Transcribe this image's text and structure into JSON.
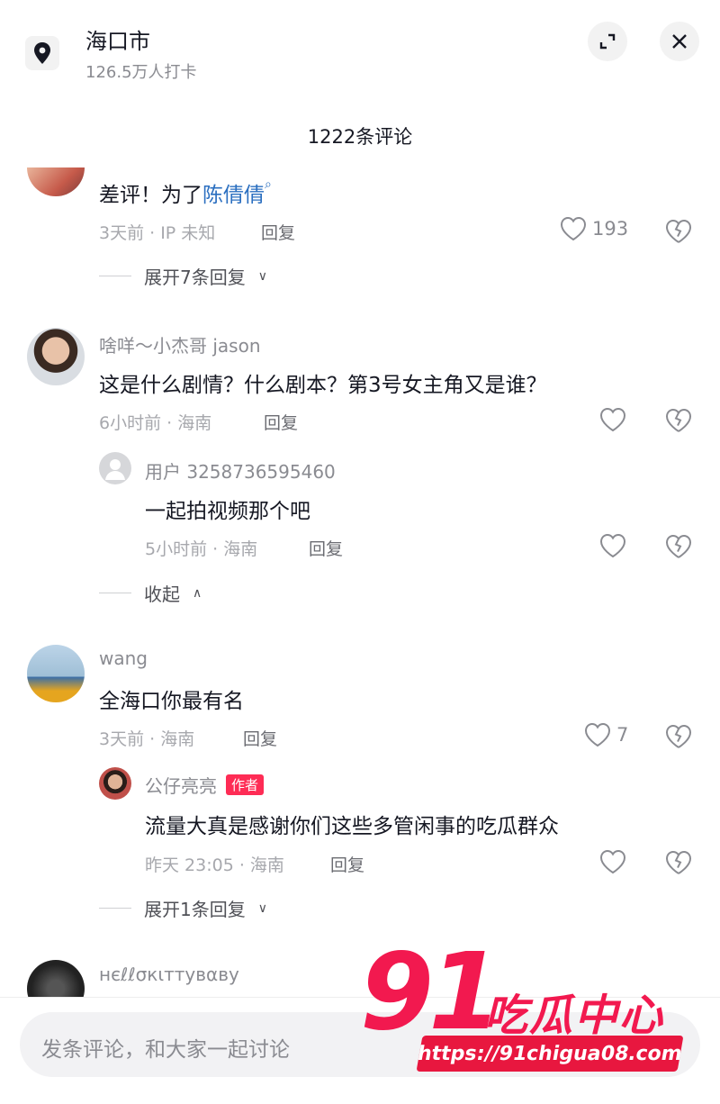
{
  "header": {
    "location": "海口市",
    "checkins": "126.5万人打卡",
    "comment_count": "1222条评论"
  },
  "comments": [
    {
      "text_plain": "差评！为了",
      "mention": "陈倩倩",
      "meta": "3天前 · IP 未知",
      "reply": "回复",
      "likes": "193",
      "expand": "展开7条回复"
    },
    {
      "user": "啥咩～小杰哥 jason",
      "text": "这是什么剧情？什么剧本？第3号女主角又是谁？",
      "meta": "6小时前 · 海南",
      "reply": "回复",
      "sub": {
        "user": "用户 3258736595460",
        "text": "一起拍视频那个吧",
        "meta": "5小时前 · 海南",
        "reply": "回复"
      },
      "collapse": "收起"
    },
    {
      "user": "wang",
      "text": "全海口你最有名",
      "meta": "3天前 · 海南",
      "reply": "回复",
      "likes": "7",
      "sub": {
        "user": "公仔亮亮",
        "badge": "作者",
        "text": "流量大真是感谢你们这些多管闲事的吃瓜群众",
        "meta": "昨天 23:05 · 海南",
        "reply": "回复"
      },
      "expand": "展开1条回复"
    },
    {
      "user": "нєℓℓσкιттувαву"
    }
  ],
  "input": {
    "placeholder": "发条评论，和大家一起讨论"
  },
  "watermark": {
    "num": "91",
    "brand": "吃瓜中心",
    "url": "https://91chigua08.com"
  },
  "colors": {
    "accent": "#fe2c55",
    "mention": "#2b6fc0",
    "watermark": "#f2194f"
  }
}
